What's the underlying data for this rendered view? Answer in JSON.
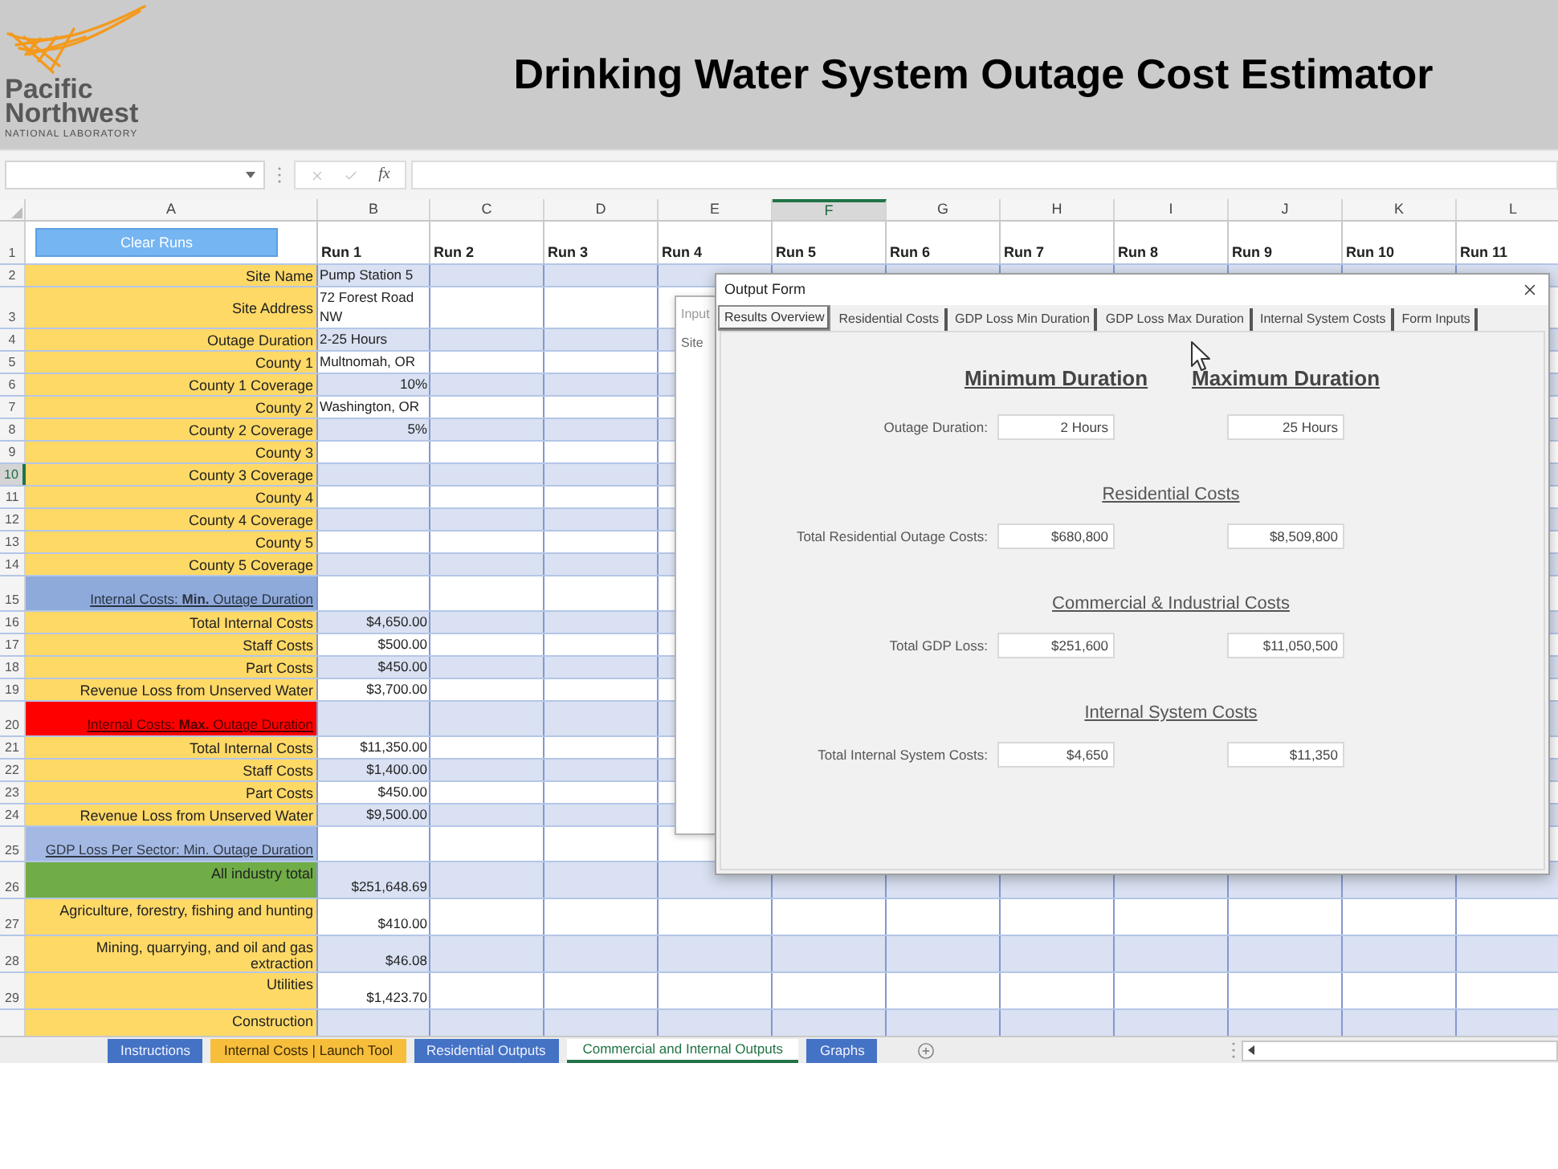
{
  "header": {
    "logo": {
      "name_lines": [
        "Pacific",
        "Northwest"
      ],
      "subtitle": "NATIONAL LABORATORY"
    },
    "title": "Drinking Water System Outage Cost Estimator"
  },
  "formula_bar": {
    "function_button": "fx"
  },
  "sheet": {
    "columns": [
      {
        "label": "A",
        "selected": false
      },
      {
        "label": "B",
        "selected": false
      },
      {
        "label": "C",
        "selected": false
      },
      {
        "label": "D",
        "selected": false
      },
      {
        "label": "E",
        "selected": false
      },
      {
        "label": "F",
        "selected": true
      },
      {
        "label": "G",
        "selected": false
      },
      {
        "label": "H",
        "selected": false
      },
      {
        "label": "I",
        "selected": false
      },
      {
        "label": "J",
        "selected": false
      },
      {
        "label": "K",
        "selected": false
      },
      {
        "label": "L",
        "selected": false
      }
    ],
    "header_row": {
      "number": "1",
      "button": "Clear Runs",
      "runs": [
        "Run 1",
        "Run 2",
        "Run 3",
        "Run 4",
        "Run 5",
        "Run 6",
        "Run 7",
        "Run 8",
        "Run 9",
        "Run 10",
        "Run 11"
      ]
    },
    "rows": [
      {
        "number": "2",
        "selected": false,
        "kind": "input",
        "color": "#ffd966",
        "label": "Site Name",
        "value": "Pump Station 5",
        "numeric": false
      },
      {
        "number": "3",
        "selected": false,
        "kind": "input",
        "color": "#ffd966",
        "label": "Site Address",
        "value": "72 Forest Road NW",
        "numeric": false
      },
      {
        "number": "4",
        "selected": false,
        "kind": "input",
        "color": "#ffd966",
        "label": "Outage Duration",
        "value": "2-25 Hours",
        "numeric": false
      },
      {
        "number": "5",
        "selected": false,
        "kind": "input",
        "color": "#ffd966",
        "label": "County 1",
        "value": "Multnomah, OR",
        "numeric": false
      },
      {
        "number": "6",
        "selected": false,
        "kind": "input",
        "color": "#ffd966",
        "label": "County 1 Coverage",
        "value": "10%",
        "numeric": true
      },
      {
        "number": "7",
        "selected": false,
        "kind": "input",
        "color": "#ffd966",
        "label": "County 2",
        "value": "Washington, OR",
        "numeric": false
      },
      {
        "number": "8",
        "selected": false,
        "kind": "input",
        "color": "#ffd966",
        "label": "County 2 Coverage",
        "value": "5%",
        "numeric": true
      },
      {
        "number": "9",
        "selected": false,
        "kind": "input",
        "color": "#ffd966",
        "label": "County 3"
      },
      {
        "number": "10",
        "selected": true,
        "kind": "input",
        "color": "#ffd966",
        "label": "County 3 Coverage"
      },
      {
        "number": "11",
        "selected": false,
        "kind": "input",
        "color": "#ffd966",
        "label": "County 4"
      },
      {
        "number": "12",
        "selected": false,
        "kind": "input",
        "color": "#ffd966",
        "label": "County 4 Coverage"
      },
      {
        "number": "13",
        "selected": false,
        "kind": "input",
        "color": "#ffd966",
        "label": "County 5"
      },
      {
        "number": "14",
        "selected": false,
        "kind": "input",
        "color": "#ffd966",
        "label": "County 5 Coverage"
      },
      {
        "number": "15",
        "selected": false,
        "kind": "section",
        "color": "#8eaadb",
        "label": "Internal Costs: **Min.** Outage Duration"
      },
      {
        "number": "16",
        "selected": false,
        "kind": "input",
        "color": "#ffd966",
        "label": "Total Internal Costs",
        "value": "$4,650.00",
        "numeric": true
      },
      {
        "number": "17",
        "selected": false,
        "kind": "input",
        "color": "#ffd966",
        "label": "Staff Costs",
        "value": "$500.00",
        "numeric": true
      },
      {
        "number": "18",
        "selected": false,
        "kind": "input",
        "color": "#ffd966",
        "label": "Part Costs",
        "value": "$450.00",
        "numeric": true
      },
      {
        "number": "19",
        "selected": false,
        "kind": "input",
        "color": "#ffd966",
        "label": "Revenue Loss from Unserved Water",
        "value": "$3,700.00",
        "numeric": true
      },
      {
        "number": "20",
        "selected": false,
        "kind": "section",
        "color": "#ff0000",
        "label": "Internal Costs: **Max.** Outage Duration"
      },
      {
        "number": "21",
        "selected": false,
        "kind": "input",
        "color": "#ffd966",
        "label": "Total Internal Costs",
        "value": "$11,350.00",
        "numeric": true
      },
      {
        "number": "22",
        "selected": false,
        "kind": "input",
        "color": "#ffd966",
        "label": "Staff Costs",
        "value": "$1,400.00",
        "numeric": true
      },
      {
        "number": "23",
        "selected": false,
        "kind": "input",
        "color": "#ffd966",
        "label": "Part Costs",
        "value": "$450.00",
        "numeric": true
      },
      {
        "number": "24",
        "selected": false,
        "kind": "input",
        "color": "#ffd966",
        "label": "Revenue Loss from Unserved Water",
        "value": "$9,500.00",
        "numeric": true
      },
      {
        "number": "25",
        "selected": false,
        "kind": "section",
        "color": "#a3b9e4",
        "label": "GDP Loss Per Sector: Min. Outage Duration"
      },
      {
        "number": "26",
        "selected": false,
        "kind": "sector",
        "color": "#70ad47",
        "label": "All industry total",
        "value": "$251,648.69",
        "numeric": true
      },
      {
        "number": "27",
        "selected": false,
        "kind": "sector",
        "color": "#ffd966",
        "label": "Agriculture, forestry, fishing and hunting",
        "value": "$410.00",
        "numeric": true
      },
      {
        "number": "28",
        "selected": false,
        "kind": "sector",
        "color": "#ffd966",
        "label": "Mining, quarrying, and oil and gas extraction",
        "value": "$46.08",
        "numeric": true
      },
      {
        "number": "29",
        "selected": false,
        "kind": "sector",
        "color": "#ffd966",
        "label": "Utilities",
        "value": "$1,423.70",
        "numeric": true
      },
      {
        "selected": false,
        "kind": "sector",
        "color": "#ffd966",
        "label": "Construction"
      }
    ]
  },
  "input_form": {
    "tab": "Input",
    "label": "Site"
  },
  "output_form": {
    "title": "Output Form",
    "tabs": [
      {
        "label": "Results Overview",
        "selected": true
      },
      {
        "label": "Residential Costs",
        "selected": false
      },
      {
        "label": "GDP Loss Min Duration",
        "selected": false
      },
      {
        "label": "GDP Loss Max Duration",
        "selected": false
      },
      {
        "label": "Internal System Costs",
        "selected": false
      },
      {
        "label": "Form Inputs",
        "selected": false
      }
    ],
    "column_headings": [
      "Minimum Duration",
      "Maximum Duration"
    ],
    "sections": [
      {
        "rows": [
          {
            "label": "Outage Duration:",
            "minimum": "2 Hours",
            "maximum": "25 Hours"
          }
        ]
      },
      {
        "title": "Residential Costs",
        "rows": [
          {
            "label": "Total Residential Outage Costs:",
            "minimum": "$680,800",
            "maximum": "$8,509,800"
          }
        ]
      },
      {
        "title": "Commercial & Industrial Costs",
        "rows": [
          {
            "label": "Total GDP Loss:",
            "minimum": "$251,600",
            "maximum": "$11,050,500"
          }
        ]
      },
      {
        "title": "Internal System Costs",
        "rows": [
          {
            "label": "Total Internal System Costs:",
            "minimum": "$4,650",
            "maximum": "$11,350"
          }
        ]
      }
    ]
  },
  "sheet_tabs": [
    {
      "label": "Instructions",
      "selected": false,
      "color": "#4472c4"
    },
    {
      "label": "Internal Costs | Launch Tool",
      "selected": false,
      "color": "#f7be3c"
    },
    {
      "label": "Residential Outputs",
      "selected": false,
      "color": "#4472c4"
    },
    {
      "label": "Commercial and Internal Outputs",
      "selected": true,
      "color": "#217346"
    },
    {
      "label": "Graphs",
      "selected": false,
      "color": "#4472c4"
    }
  ]
}
